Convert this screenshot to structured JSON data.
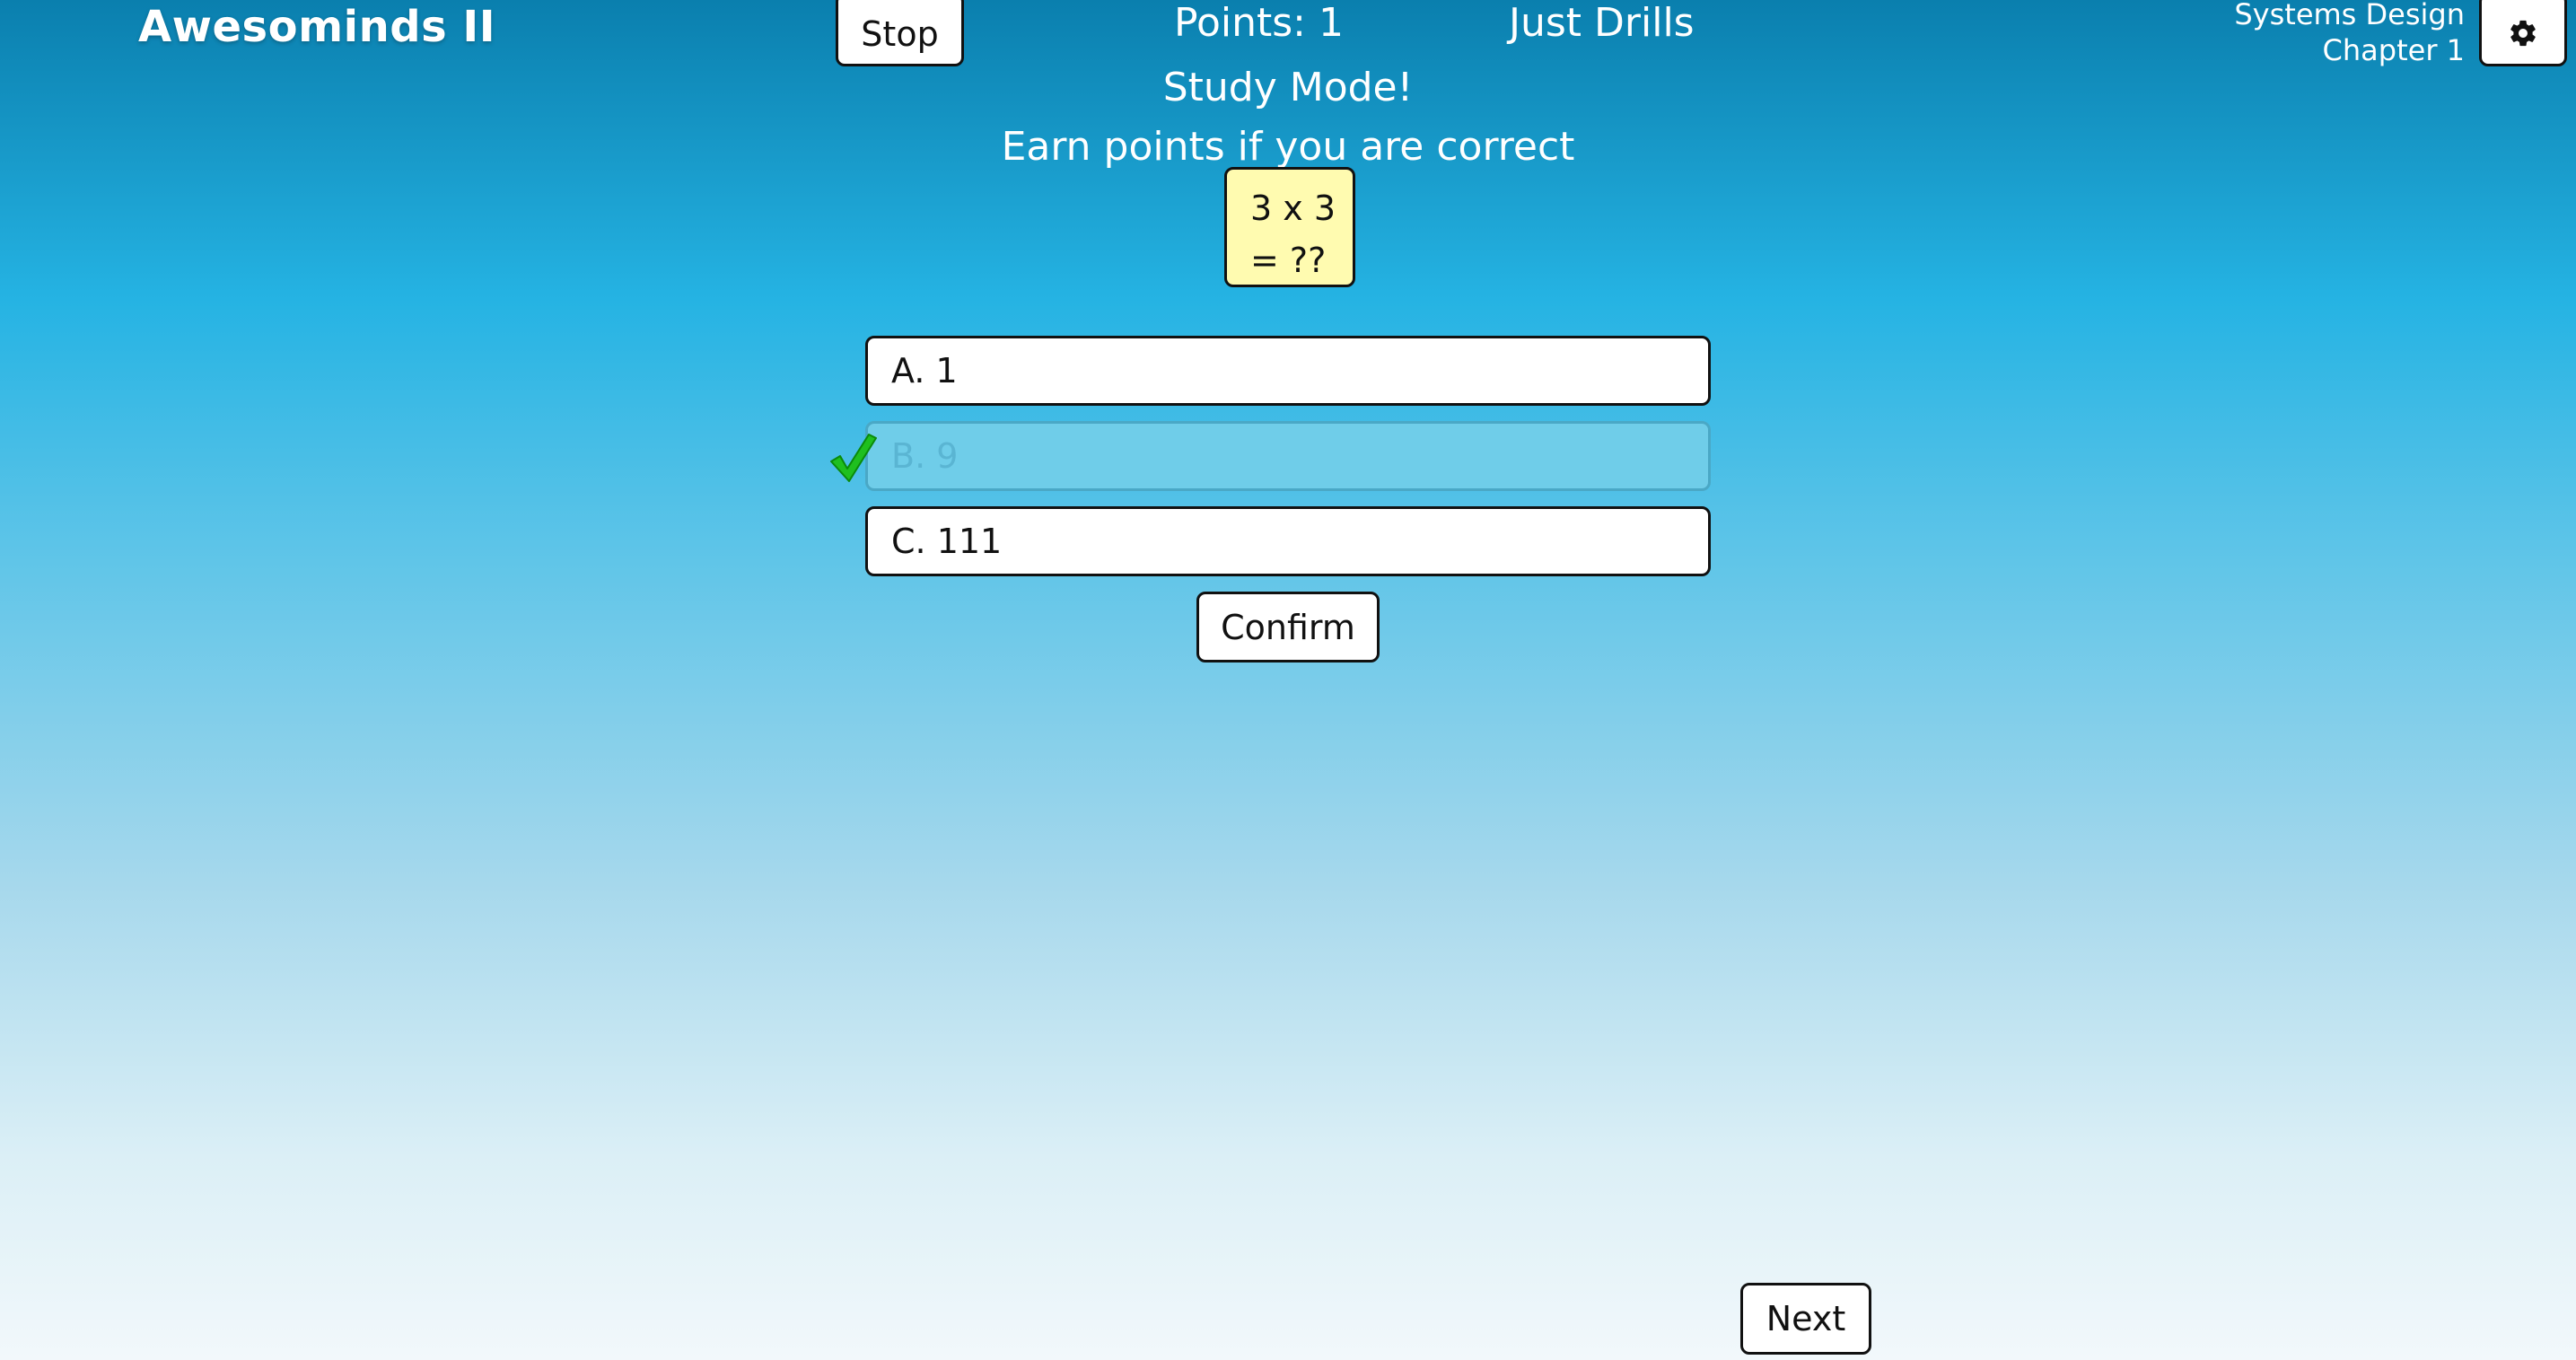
{
  "app": {
    "title": "Awesominds II"
  },
  "header": {
    "stop_label": "Stop",
    "points": "Points: 1",
    "mode": "Just Drills",
    "course_line1": "Systems Design",
    "course_line2": "Chapter 1",
    "settings_icon": "gear-icon"
  },
  "banner": {
    "title": "Study Mode!",
    "subtitle": "Earn points if you are correct"
  },
  "question": {
    "line1": "3 x 3",
    "line2": "= ??"
  },
  "options": [
    {
      "label": "A. 1",
      "selected": false
    },
    {
      "label": "B. 9",
      "selected": true,
      "correct_icon": "checkmark-icon"
    },
    {
      "label": "C. 111",
      "selected": false
    }
  ],
  "actions": {
    "confirm_label": "Confirm",
    "next_label": "Next"
  },
  "colors": {
    "selected_option_bg": "#6fcde9",
    "question_card_bg": "#fffbb0",
    "checkmark": "#1fbf1f"
  }
}
